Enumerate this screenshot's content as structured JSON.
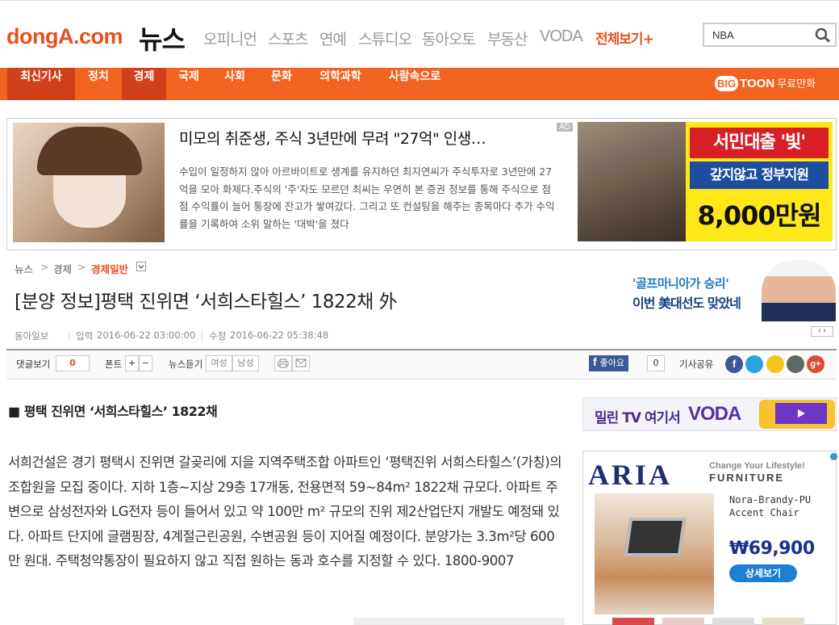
{
  "header": {
    "logo": "dongA.com",
    "section_logo": "뉴스",
    "nav": [
      "오피니언",
      "스포츠",
      "연예",
      "스튜디오",
      "동아오토",
      "부동산",
      "VODA"
    ],
    "nav_all": "전체보기",
    "nav_all_plus": "+",
    "search_value": "NBA"
  },
  "gnb": {
    "items": [
      "최신기사",
      "정치",
      "경제",
      "국제",
      "사회",
      "문화",
      "의학과학",
      "사람속으로"
    ],
    "active": "경제",
    "bigtoon_big": "BIG",
    "bigtoon_toon": "TOON",
    "bigtoon_label": "무료만화"
  },
  "ad_top": {
    "title": "미모의 취준생, 주식 3년만에 무려 \"27억\" 인생…",
    "body": "수입이 일정하지 않아 아르바이트로 생계를 유지하던 최지연씨가 주식투자로 3년만에 27억을 모아 화제다.주식의 '주'자도 모르던 최씨는 우연히 본 증권 정보를 통해 주식으로 점점 수익률이 늘어 통장에 잔고가 쌓여갔다. 그리고 또 컨설팅을 해주는 종목마다 추가 수익률을 기록하여 소위 말하는 '대박'을 쳤다",
    "badge": "AD",
    "banner_line1": "서민대출 '빛'",
    "banner_line2": "갚지않고 정부지원",
    "banner_amount": "8,000만원"
  },
  "breadcrumb": {
    "items": [
      "뉴스",
      "경제",
      "경제일반"
    ],
    "sep": ">"
  },
  "article": {
    "headline": "[분양 정보]평택 진위면 ‘서희스타힐스’ 1822채 外",
    "source": "동아일보",
    "input_label": "입력",
    "input_time": "2016-06-22 03:00:00",
    "modified_label": "수정",
    "modified_time": "2016-06-22 05:38:48",
    "subhead": "■ 평택 진위면 ‘서희스타힐스’ 1822채",
    "body": "서희건설은 경기 평택시 진위면 갈곶리에 지을 지역주택조합 아파트인 ‘평택진위 서희스타힐스’(가칭)의 조합원을 모집 중이다. 지하 1층~지상 29층 17개동, 전용면적 59~84m² 1822채 규모다. 아파트 주변으로 삼성전자와 LG전자 등이 들어서 있고 약 100만 m² 규모의 진위 제2산업단지 개발도 예정돼 있다. 아파트 단지에 글램핑장, 4계절근린공원, 수변공원 등이 지어질 예정이다. 분양가는 3.3m²당 600만 원대. 주택청약통장이 필요하지 않고 직접 원하는 동과 호수를 지정할 수 있다. 1800-9007"
  },
  "ad_right": {
    "line1": "'골프마니아가 승리'",
    "line2": "이번 美대선도 맞았네"
  },
  "toolbar": {
    "comments_label": "댓글보기",
    "comments_count": "0",
    "font_label": "폰트",
    "font_plus": "+",
    "font_minus": "−",
    "listen_label": "뉴스듣기",
    "female": "여성",
    "male": "남성",
    "like_label": "좋아요",
    "like_count": "0",
    "share_label": "기사공유"
  },
  "ad_voda": {
    "text": "밀린 TV 여기서",
    "brand": "VODA"
  },
  "ad_aria": {
    "brand": "ARIA",
    "tagline": "Change Your Lifestyle!",
    "furniture": "FURNITURE",
    "product_line1": "Nora-Brandy-PU",
    "product_line2": "Accent Chair",
    "price": "₩69,900",
    "button": "상세보기"
  },
  "colors": {
    "brand_orange": "#f26322",
    "active_tab": "#d0401a",
    "facebook": "#3b5998"
  }
}
